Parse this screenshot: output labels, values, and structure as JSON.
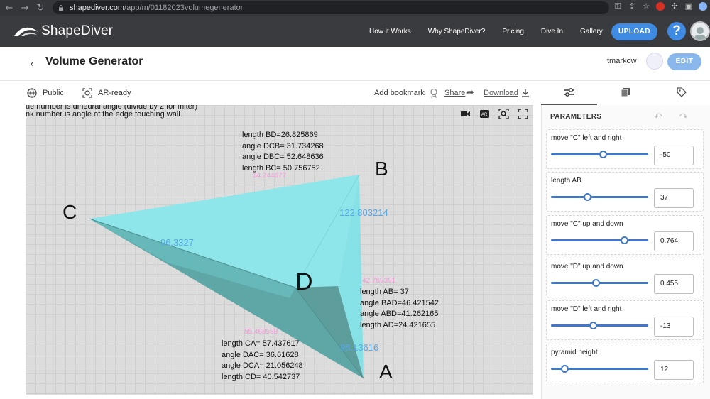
{
  "browser": {
    "url_host": "shapediver.com",
    "url_path": "/app/m/01182023volumegenerator"
  },
  "header": {
    "logo_text": "ShapeDiver",
    "nav": [
      "How it Works",
      "Why ShapeDiver?",
      "Pricing",
      "Dive In",
      "Gallery"
    ],
    "upload_label": "UPLOAD",
    "help_label": "?"
  },
  "title_bar": {
    "title": "Volume Generator",
    "username": "tmarkow",
    "edit_label": "EDIT"
  },
  "sub_bar": {
    "visibility": "Public",
    "ar_label": "AR-ready",
    "bookmark_label": "Add bookmark",
    "share_label": "Share",
    "download_label": "Download"
  },
  "viewer": {
    "note_line1": "ue number is dinedral angle (divide by 2 for miter)",
    "note_line2": "nk number is angle of the edge touching wall",
    "vertices": {
      "a": "A",
      "b": "B",
      "c": "C",
      "d": "D"
    },
    "measure_bd": [
      "length BD=26.825869",
      "angle DCB= 31.734268",
      "angle DBC= 52.648636",
      "length BC= 50.756752"
    ],
    "measure_ab": [
      "length AB= 37",
      "angle BAD=46.421542",
      "angle ABD=41.262165",
      "length AD=24.421655"
    ],
    "measure_ca": [
      "length CA= 57.437617",
      "angle DAC= 36.61628",
      "angle DCA= 21.056248",
      "length CD= 40.542737"
    ],
    "blue_labels": [
      "122.803214",
      "96.3327",
      "98.13616"
    ],
    "pink_labels": [
      "34.244677",
      "42.769391",
      "55.468588"
    ]
  },
  "panel": {
    "header": "PARAMETERS",
    "params": [
      {
        "label": "move \"C\" left and right",
        "value": "-50",
        "fraction": 0.53
      },
      {
        "label": "length AB",
        "value": "37",
        "fraction": 0.37
      },
      {
        "label": "move \"C\" up and down",
        "value": "0.764",
        "fraction": 0.75
      },
      {
        "label": "move \"D\" up and down",
        "value": "0.455",
        "fraction": 0.46
      },
      {
        "label": "move \"D\" left and right",
        "value": "-13",
        "fraction": 0.43
      },
      {
        "label": "pyramid height",
        "value": "12",
        "fraction": 0.14
      }
    ]
  },
  "colors": {
    "accent": "#3f8ae2",
    "face_light": "#8ee6ea",
    "face_mid": "#6cc6c8",
    "face_dark": "#4f9e9e",
    "dihedral_label": "#56a6e6",
    "edge_angle_label": "#f09ad8"
  }
}
